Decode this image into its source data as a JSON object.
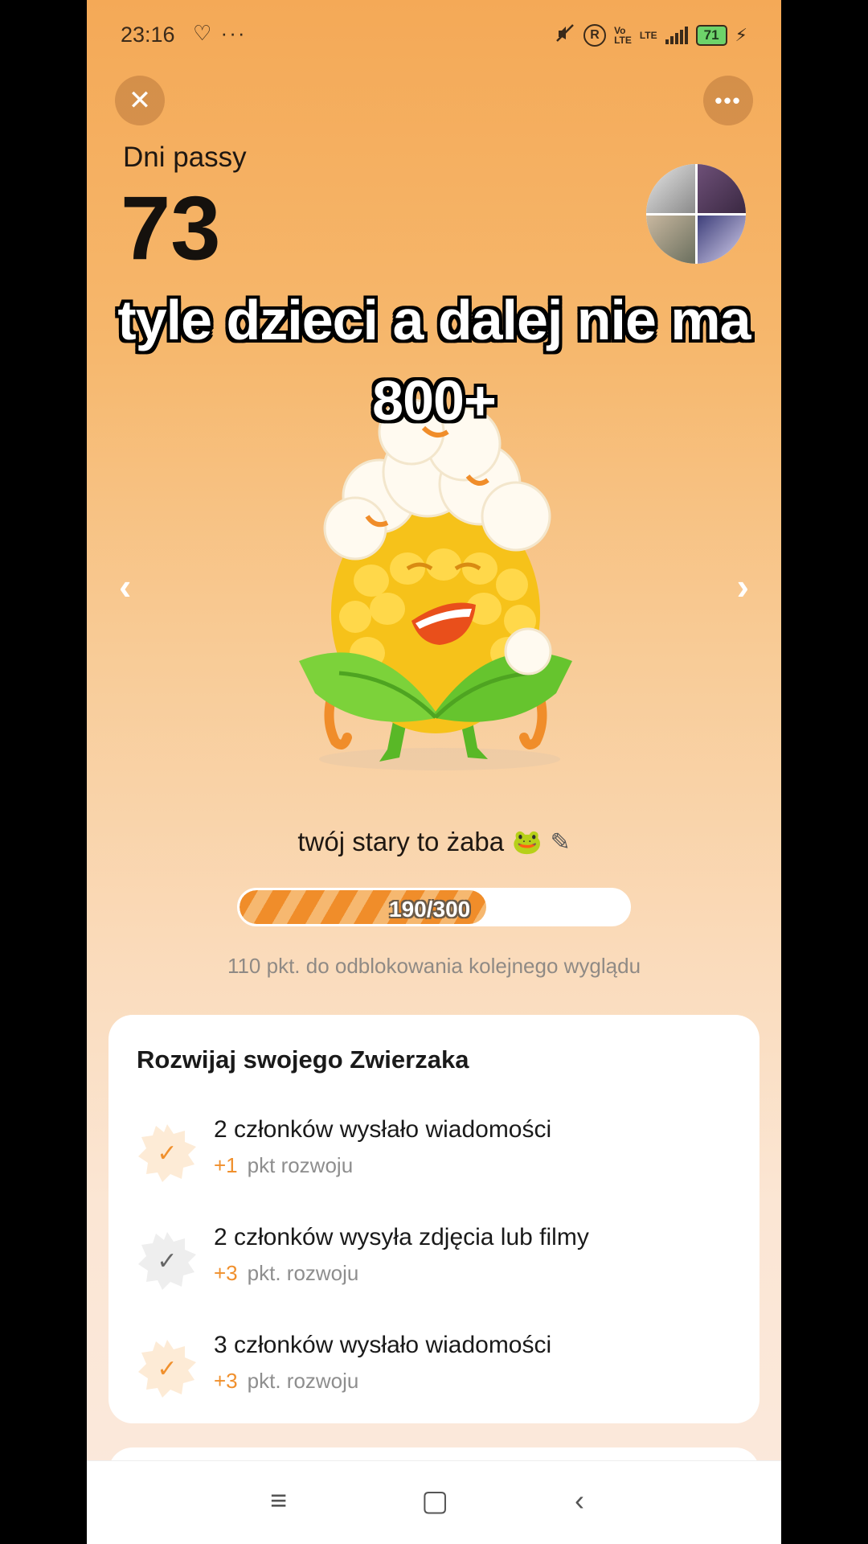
{
  "status_bar": {
    "time": "23:16",
    "left_icons": "♡ ···",
    "icon_circle": "R",
    "net_label_top": "Vo",
    "net_label_bottom": "LTE",
    "lte_label": "LTE",
    "battery": "71",
    "charging_glyph": "⚡"
  },
  "header": {
    "close_glyph": "✕",
    "more_glyph": "•••",
    "streak_label": "Dni passy",
    "streak_value": "73"
  },
  "caption": {
    "line1": "tyle dzieci a dalej nie ma",
    "line2": "800+"
  },
  "carousel": {
    "prev_glyph": "‹",
    "next_glyph": "›"
  },
  "pet": {
    "name": "twój stary to żaba",
    "emoji": "🐸",
    "edit_glyph": "✎",
    "progress_current": 190,
    "progress_max": 300,
    "progress_text": "190/300",
    "unlock_hint": "110 pkt. do odblokowania kolejnego wyglądu"
  },
  "tasks_card": {
    "title": "Rozwijaj swojego Zwierzaka",
    "tasks": [
      {
        "title": "2 członków wysłało wiadomości",
        "points": "+1",
        "points_label": "pkt rozwoju",
        "status": "done",
        "badge_color": "#f0902d"
      },
      {
        "title": "2 członków wysyła zdjęcia lub filmy",
        "points": "+3",
        "points_label": "pkt. rozwoju",
        "status": "pending",
        "badge_color": "#666666"
      },
      {
        "title": "3 członków wysłało wiadomości",
        "points": "+3",
        "points_label": "pkt. rozwoju",
        "status": "done",
        "badge_color": "#f0902d"
      }
    ],
    "check_glyph": "✓"
  },
  "nav_bar": {
    "menu_glyph": "≡",
    "home_glyph": "▢",
    "back_glyph": "‹"
  },
  "colors": {
    "accent": "#f0902d",
    "progress_fill": "#f08d2a"
  }
}
